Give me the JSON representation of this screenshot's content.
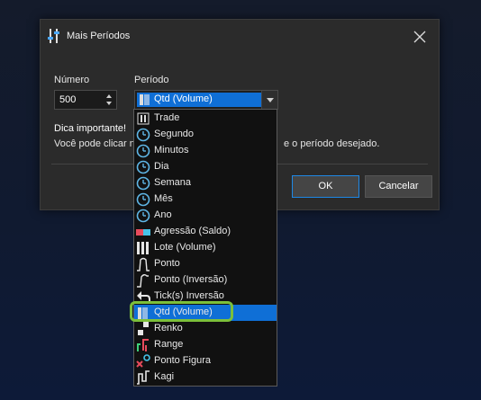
{
  "dialog": {
    "title": "Mais Períodos",
    "numero_label": "Número",
    "numero_value": "500",
    "periodo_label": "Período",
    "periodo_selected": "Qtd (Volume)",
    "tip_title": "Dica importante!",
    "tip_text_left": "Você pode clicar no",
    "tip_text_right": "e o período desejado.",
    "ok_label": "OK",
    "cancel_label": "Cancelar"
  },
  "dropdown": {
    "items": [
      {
        "label": "Trade",
        "icon": "trade-icon"
      },
      {
        "label": "Segundo",
        "icon": "clock-icon"
      },
      {
        "label": "Minutos",
        "icon": "clock-icon"
      },
      {
        "label": "Dia",
        "icon": "clock-icon"
      },
      {
        "label": "Semana",
        "icon": "clock-icon"
      },
      {
        "label": "Mês",
        "icon": "clock-icon"
      },
      {
        "label": "Ano",
        "icon": "clock-icon"
      },
      {
        "label": "Agressão (Saldo)",
        "icon": "aggression-icon"
      },
      {
        "label": "Lote (Volume)",
        "icon": "bars-icon"
      },
      {
        "label": "Ponto",
        "icon": "point-icon"
      },
      {
        "label": "Ponto (Inversão)",
        "icon": "point-inversion-icon"
      },
      {
        "label": "Tick(s) Inversão",
        "icon": "undo-arrow-icon"
      },
      {
        "label": "Qtd (Volume)",
        "icon": "volume-icon",
        "selected": true
      },
      {
        "label": "Renko",
        "icon": "renko-icon"
      },
      {
        "label": "Range",
        "icon": "range-icon"
      },
      {
        "label": "Ponto Figura",
        "icon": "point-figure-icon"
      },
      {
        "label": "Kagi",
        "icon": "kagi-icon"
      }
    ]
  },
  "colors": {
    "accent": "#0f6fd6",
    "highlight": "#7cc03a",
    "clock": "#5fb6e6"
  }
}
